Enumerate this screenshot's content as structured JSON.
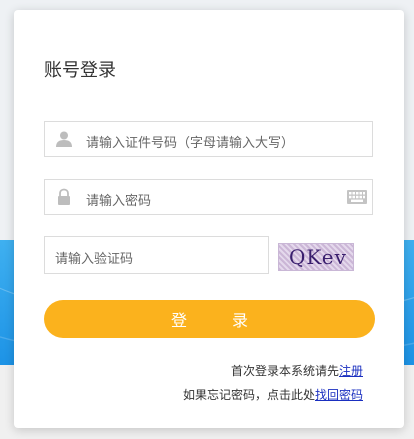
{
  "login": {
    "title": "账号登录",
    "username_placeholder": "请输入证件号码（字母请输入大写）",
    "password_placeholder": "请输入密码",
    "captcha_placeholder": "请输入验证码",
    "captcha_text": "QKev",
    "login_button": "登 录"
  },
  "footer": {
    "register_prompt": "首次登录本系统请先",
    "register_link": "注册",
    "forgot_prompt": "如果忘记密码，点击此处",
    "forgot_link": "找回密码"
  },
  "colors": {
    "button": "#fbb21d",
    "link": "#1a2fc0",
    "background_band": "#1d93e6"
  },
  "icons": {
    "username": "user-icon",
    "password": "lock-icon",
    "keyboard": "keyboard-icon"
  }
}
